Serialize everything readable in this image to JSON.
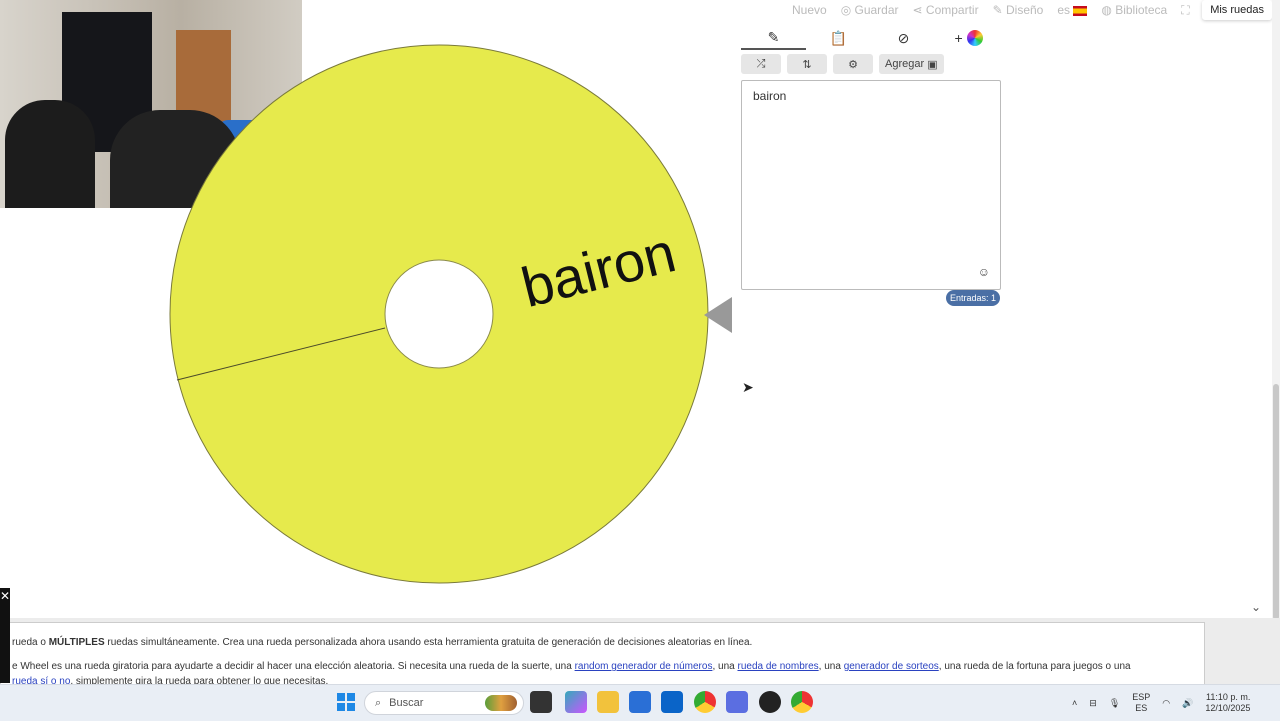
{
  "topnav": {
    "nuevo": "Nuevo",
    "guardar": "Guardar",
    "compartir": "Compartir",
    "diseno": "Diseño",
    "lang": "es",
    "biblioteca": "Biblioteca",
    "mis_ruedas": "Mis ruedas"
  },
  "wheel": {
    "label": "bairon",
    "color": "#e6ea4c",
    "pointer_color": "#999999"
  },
  "panel": {
    "toolbar_add": "Agregar",
    "entries_text": "bairon",
    "count_badge": "Entradas: 1"
  },
  "bottom": {
    "line1_prefix": "rueda o ",
    "line1_bold": "MÚLTIPLES",
    "line1_suffix": " ruedas simultáneamente. Crea una rueda personalizada ahora usando esta herramienta gratuita de generación de decisiones aleatorias en línea.",
    "line2_a": "e Wheel es una rueda giratoria para ayudarte a decidir al hacer una elección aleatoria. Si necesita una rueda de la suerte, una ",
    "link1": "random generador de números",
    "line2_b": ", una ",
    "link2": "rueda de nombres",
    "line2_c": ", una ",
    "link3": "generador de sorteos",
    "line2_d": ", una rueda de la fortuna para juegos o una",
    "line3_link": "rueda sí o no",
    "line3_rest": ", simplemente gira la rueda para obtener lo que necesitas."
  },
  "taskbar": {
    "search_placeholder": "Buscar",
    "lang_top": "ESP",
    "lang_bottom": "ES",
    "time": "11:10 p. m.",
    "date": "12/10/2025"
  }
}
